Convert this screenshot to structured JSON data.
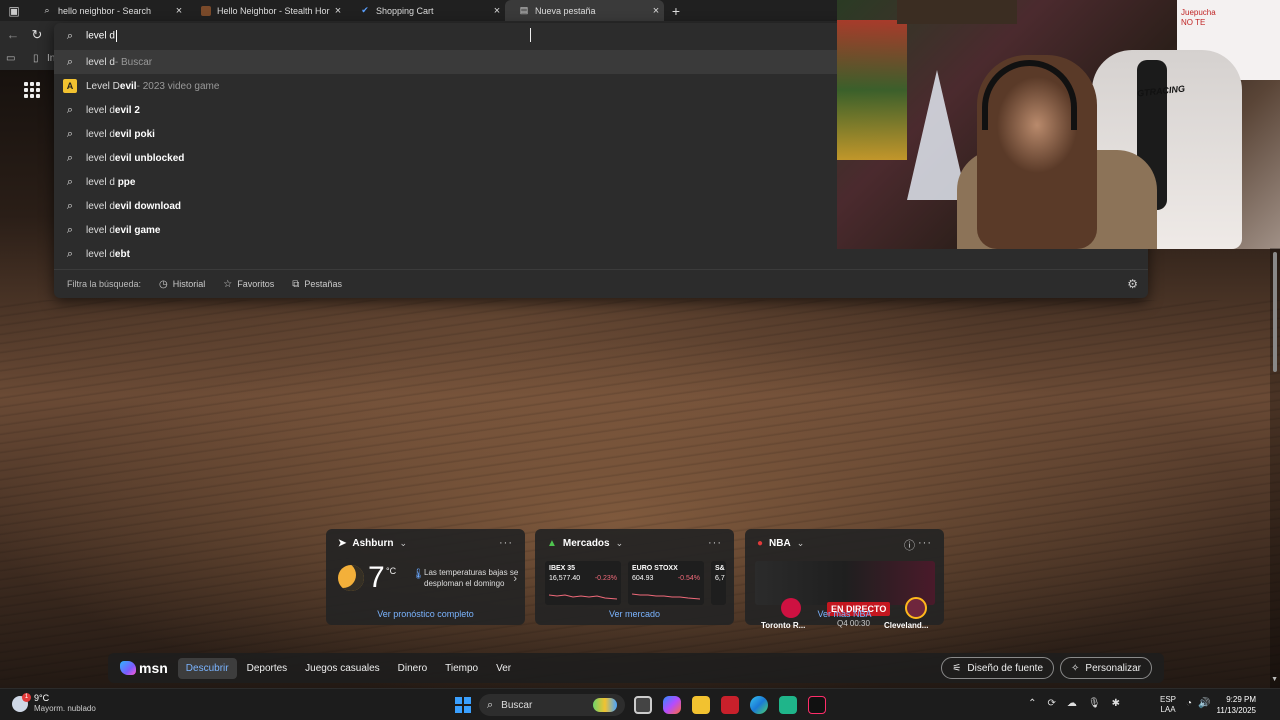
{
  "browser": {
    "tabs": [
      {
        "label": "hello neighbor - Search",
        "icon": "search-icon",
        "active": false
      },
      {
        "label": "Hello Neighbor - Stealth Horror G",
        "icon": "game-thumbnail-icon",
        "active": false
      },
      {
        "label": "Shopping Cart",
        "icon": "checkmark-icon",
        "active": false
      },
      {
        "label": "Nueva pestaña",
        "icon": "newtab-page-icon",
        "active": true
      }
    ],
    "address_value": "level d",
    "favorites_bar_partial": "In"
  },
  "suggestions": [
    {
      "prefix": "level d",
      "bold": "",
      "sub": " - Buscar",
      "icon": "search-icon",
      "highlight": true
    },
    {
      "prefix": "Level D",
      "bold": "evil",
      "sub": " - 2023 video game",
      "icon": "entity-icon",
      "highlight": false
    },
    {
      "prefix": "level d",
      "bold": "evil 2",
      "sub": "",
      "icon": "search-icon",
      "highlight": false
    },
    {
      "prefix": "level d",
      "bold": "evil poki",
      "sub": "",
      "icon": "search-icon",
      "highlight": false
    },
    {
      "prefix": "level d",
      "bold": "evil unblocked",
      "sub": "",
      "icon": "search-icon",
      "highlight": false
    },
    {
      "prefix": "level d ",
      "bold": "ppe",
      "sub": "",
      "icon": "search-icon",
      "highlight": false
    },
    {
      "prefix": "level d",
      "bold": "evil download",
      "sub": "",
      "icon": "search-icon",
      "highlight": false
    },
    {
      "prefix": "level d",
      "bold": "evil game",
      "sub": "",
      "icon": "search-icon",
      "highlight": false
    },
    {
      "prefix": "level d",
      "bold": "ebt",
      "sub": "",
      "icon": "search-icon",
      "highlight": false
    }
  ],
  "suggest_entity_badge": "A",
  "filter": {
    "label": "Filtra la búsqueda:",
    "chips": [
      {
        "label": "Historial",
        "icon": "history-icon"
      },
      {
        "label": "Favoritos",
        "icon": "star-icon"
      },
      {
        "label": "Pestañas",
        "icon": "tabs-icon"
      }
    ]
  },
  "webcam": {
    "chair_brand": "GTRACING",
    "whiteboard_text": "Juepucha\nNO TE"
  },
  "weather_widget": {
    "location": "Ashburn",
    "temp": "7",
    "unit": "°C",
    "description": "Las temperaturas bajas se desploman el domingo",
    "link": "Ver pronóstico completo"
  },
  "markets_widget": {
    "title": "Mercados",
    "tickers": [
      {
        "name": "IBEX 35",
        "value": "16,577.40",
        "change": "-0.23%"
      },
      {
        "name": "EURO STOXX",
        "value": "604.93",
        "change": "-0.54%"
      },
      {
        "name": "S&",
        "value": "6,7",
        "change": ""
      }
    ],
    "link": "Ver mercado"
  },
  "nba_widget": {
    "title": "NBA",
    "status": "EN DIRECTO",
    "period": "Q4 00:30",
    "home": "Toronto R...",
    "away": "Cleveland...",
    "link": "Ver más NBA"
  },
  "msn": {
    "logo": "msn",
    "nav": [
      {
        "label": "Descubrir",
        "active": true
      },
      {
        "label": "Deportes",
        "active": false
      },
      {
        "label": "Juegos casuales",
        "active": false
      },
      {
        "label": "Dinero",
        "active": false
      },
      {
        "label": "Tiempo",
        "active": false
      },
      {
        "label": "Ver",
        "active": false
      }
    ],
    "font_button": "Diseño de fuente",
    "personalize_button": "Personalizar"
  },
  "taskbar": {
    "weather_temp": "9°C",
    "weather_desc": "Mayorm. nublado",
    "weather_badge": "1",
    "search_label": "Buscar",
    "lang_top": "ESP",
    "lang_bottom": "LAA",
    "time": "9:29 PM",
    "date": "11/13/2025"
  },
  "colors": {
    "accent": "#7ab4ff",
    "live": "#c4171f",
    "negative": "#f06a7a"
  }
}
